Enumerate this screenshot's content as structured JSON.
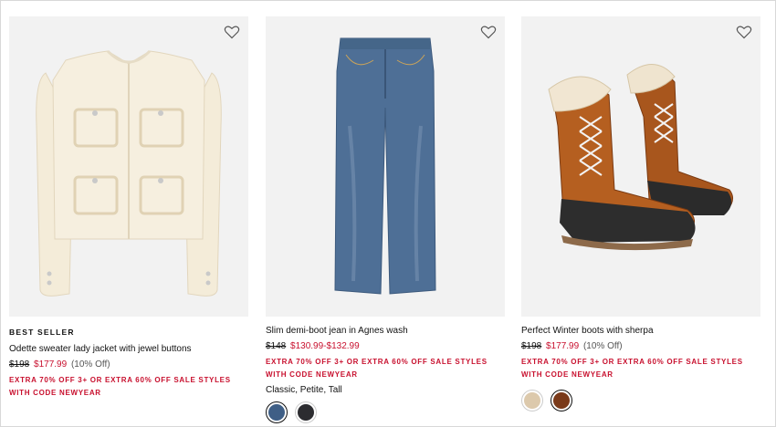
{
  "products": [
    {
      "badge": "BEST SELLER",
      "title": "Odette sweater lady jacket with jewel buttons",
      "original_price": "$198",
      "sale_price": "$177.99",
      "discount": "(10% Off)",
      "promo": "EXTRA 70% OFF 3+ OR EXTRA 60% OFF SALE STYLES WITH CODE NEWYEAR",
      "image_icon": "cream-sweater-jacket-image",
      "wishlist_icon": "heart-icon"
    },
    {
      "badge": "",
      "title": "Slim demi-boot jean in Agnes wash",
      "original_price": "$148",
      "sale_price": "$130.99-$132.99",
      "discount": "",
      "promo": "EXTRA 70% OFF 3+ OR EXTRA 60% OFF SALE STYLES WITH CODE NEWYEAR",
      "fits": "Classic, Petite, Tall",
      "swatches": [
        "#3f5f86",
        "#2c2c30"
      ],
      "image_icon": "blue-jeans-image",
      "wishlist_icon": "heart-icon"
    },
    {
      "badge": "",
      "title": "Perfect Winter boots with sherpa",
      "original_price": "$198",
      "sale_price": "$177.99",
      "discount": "(10% Off)",
      "promo": "EXTRA 70% OFF 3+ OR EXTRA 60% OFF SALE STYLES WITH CODE NEWYEAR",
      "swatches": [
        "#dcc9ac",
        "#7a3a1a"
      ],
      "image_icon": "winter-boots-image",
      "wishlist_icon": "heart-icon"
    }
  ],
  "colors": {
    "sale": "#c8102e",
    "image_bg": "#f2f2f2"
  }
}
